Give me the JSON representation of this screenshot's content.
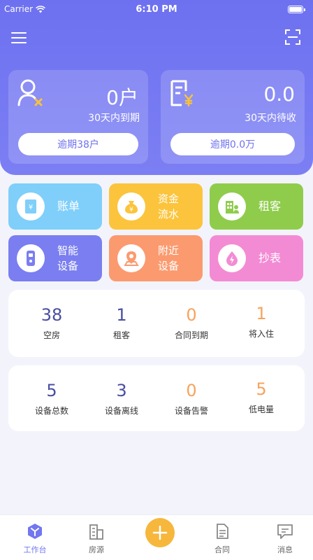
{
  "status_bar": {
    "carrier": "Carrier",
    "time": "6:10 PM"
  },
  "summary": {
    "left": {
      "value": "0户",
      "subtitle": "30天内到期",
      "button": "逾期38户"
    },
    "right": {
      "value": "0.0",
      "subtitle": "30天内待收",
      "button": "逾期0.0万"
    }
  },
  "tiles": [
    {
      "label": "账单",
      "color": "#7fcffa",
      "icon": "bill-icon"
    },
    {
      "label": "资金\n流水",
      "line1": "资金",
      "line2": "流水",
      "color": "#fbc43c",
      "icon": "money-bag-icon"
    },
    {
      "label": "租客",
      "color": "#8fcc4c",
      "icon": "tenant-icon"
    },
    {
      "label": "智能\n设备",
      "line1": "智能",
      "line2": "设备",
      "color": "#7a7ef0",
      "icon": "smart-lock-icon"
    },
    {
      "label": "附近\n设备",
      "line1": "附近",
      "line2": "设备",
      "color": "#fb9a6f",
      "icon": "location-icon"
    },
    {
      "label": "抄表",
      "color": "#f38bd4",
      "icon": "meter-reading-icon"
    }
  ],
  "stats_rooms": [
    {
      "value": "38",
      "label": "空房",
      "color": "#4a4ea0"
    },
    {
      "value": "1",
      "label": "租客",
      "color": "#4a4ea0"
    },
    {
      "value": "0",
      "label": "合同到期",
      "color": "#f7a35c"
    },
    {
      "value": "1",
      "label": "将入住",
      "color": "#f7a35c"
    }
  ],
  "stats_devices": [
    {
      "value": "5",
      "label": "设备总数",
      "color": "#4a4ea0"
    },
    {
      "value": "3",
      "label": "设备离线",
      "color": "#4a4ea0"
    },
    {
      "value": "0",
      "label": "设备告警",
      "color": "#f7a35c"
    },
    {
      "value": "5",
      "label": "低电量",
      "color": "#f7a35c"
    }
  ],
  "nav": {
    "workbench": "工作台",
    "listings": "房源",
    "contracts": "合同",
    "messages": "消息"
  },
  "colors": {
    "primary": "#7276f0",
    "accent": "#f6b73c"
  }
}
